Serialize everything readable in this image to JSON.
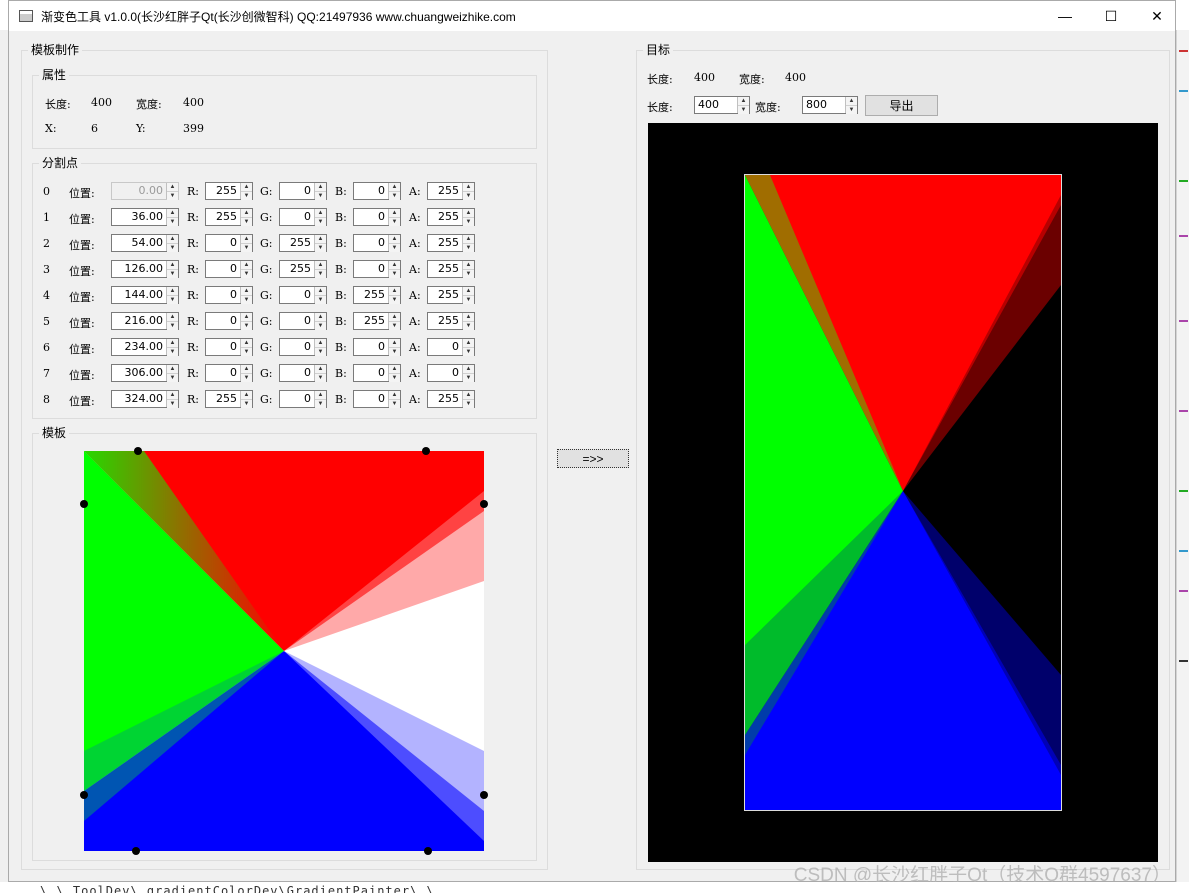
{
  "window": {
    "title": "渐变色工具 v1.0.0(长沙红胖子Qt(长沙创微智科) QQ:21497936 www.chuangweizhike.com",
    "minimize": "—",
    "maximize": "☐",
    "close": "✕"
  },
  "template_group": {
    "title": "模板制作",
    "props": {
      "title": "属性",
      "length_label": "长度:",
      "length_value": "400",
      "width_label": "宽度:",
      "width_value": "400",
      "x_label": "X:",
      "x_value": "6",
      "y_label": "Y:",
      "y_value": "399"
    },
    "stops": {
      "title": "分割点",
      "pos_label": "位置:",
      "r_label": "R:",
      "g_label": "G:",
      "b_label": "B:",
      "a_label": "A:",
      "rows": [
        {
          "index": "0",
          "pos": "0.00",
          "r": "255",
          "g": "0",
          "b": "0",
          "a": "255",
          "pos_disabled": true
        },
        {
          "index": "1",
          "pos": "36.00",
          "r": "255",
          "g": "0",
          "b": "0",
          "a": "255"
        },
        {
          "index": "2",
          "pos": "54.00",
          "r": "0",
          "g": "255",
          "b": "0",
          "a": "255"
        },
        {
          "index": "3",
          "pos": "126.00",
          "r": "0",
          "g": "255",
          "b": "0",
          "a": "255"
        },
        {
          "index": "4",
          "pos": "144.00",
          "r": "0",
          "g": "0",
          "b": "255",
          "a": "255"
        },
        {
          "index": "5",
          "pos": "216.00",
          "r": "0",
          "g": "0",
          "b": "255",
          "a": "255"
        },
        {
          "index": "6",
          "pos": "234.00",
          "r": "0",
          "g": "0",
          "b": "0",
          "a": "0"
        },
        {
          "index": "7",
          "pos": "306.00",
          "r": "0",
          "g": "0",
          "b": "0",
          "a": "0"
        },
        {
          "index": "8",
          "pos": "324.00",
          "r": "255",
          "g": "0",
          "b": "0",
          "a": "255"
        }
      ]
    },
    "preview": {
      "title": "模板"
    }
  },
  "apply_button": "=>>",
  "target_group": {
    "title": "目标",
    "length_label": "长度:",
    "length_value": "400",
    "width_label": "宽度:",
    "width_value": "400",
    "length_input_label": "长度:",
    "length_input": "400",
    "width_input_label": "宽度:",
    "width_input": "800",
    "export_button": "导出"
  },
  "colors": {
    "red": "#ff0000",
    "green": "#00ff00",
    "blue": "#0000ff",
    "background": "#f0f0f0",
    "target_bg": "#000000"
  },
  "watermark": "CSDN @长沙红胖子Qt（技术Q群4597637）",
  "background_text": "\\ \\ ToolDev\\ gradientColorDev\\GradientPainter\\ \\ "
}
